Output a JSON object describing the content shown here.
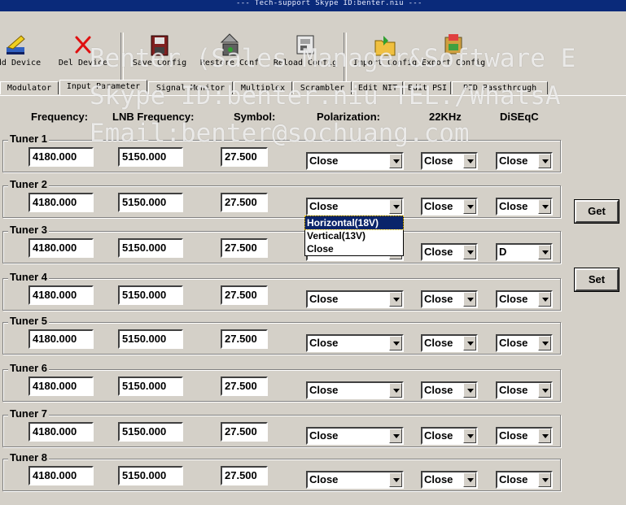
{
  "window": {
    "title": "--- Tech-support Skype ID:benter.niu ---"
  },
  "toolbar": {
    "items": [
      {
        "label": "Add Device",
        "icon": "add-device-icon"
      },
      {
        "label": "Del Device",
        "icon": "delete-icon"
      },
      {
        "label": "Save Config",
        "icon": "save-config-icon"
      },
      {
        "label": "Restore Conf",
        "icon": "restore-config-icon"
      },
      {
        "label": "Reload Config",
        "icon": "reload-config-icon"
      },
      {
        "label": "Import Config",
        "icon": "import-config-icon"
      },
      {
        "label": "Export Config",
        "icon": "export-config-icon"
      }
    ]
  },
  "tabs": [
    "Modulator",
    "Input Parameter",
    "Signal Monitor",
    "Multiplex",
    "Scrambler",
    "Edit NIT",
    "Edit PSI",
    "PID Passthrough"
  ],
  "active_tab": "Input Parameter",
  "headers": {
    "frequency": "Frequency:",
    "lnb": "LNB Frequency:",
    "symbol": "Symbol:",
    "polarization": "Polarization:",
    "khz": "22KHz",
    "diseqc": "DiSEqC"
  },
  "tuners": [
    {
      "name": "Tuner 1",
      "frequency": "4180.000",
      "lnb": "5150.000",
      "symbol": "27.500",
      "polarization": "Close",
      "khz": "Close",
      "diseqc": "Close"
    },
    {
      "name": "Tuner 2",
      "frequency": "4180.000",
      "lnb": "5150.000",
      "symbol": "27.500",
      "polarization": "Close",
      "khz": "Close",
      "diseqc": "Close"
    },
    {
      "name": "Tuner 3",
      "frequency": "4180.000",
      "lnb": "5150.000",
      "symbol": "27.500",
      "polarization": "",
      "khz": "Close",
      "diseqc": "D"
    },
    {
      "name": "Tuner 4",
      "frequency": "4180.000",
      "lnb": "5150.000",
      "symbol": "27.500",
      "polarization": "Close",
      "khz": "Close",
      "diseqc": "Close"
    },
    {
      "name": "Tuner 5",
      "frequency": "4180.000",
      "lnb": "5150.000",
      "symbol": "27.500",
      "polarization": "Close",
      "khz": "Close",
      "diseqc": "Close"
    },
    {
      "name": "Tuner 6",
      "frequency": "4180.000",
      "lnb": "5150.000",
      "symbol": "27.500",
      "polarization": "Close",
      "khz": "Close",
      "diseqc": "Close"
    },
    {
      "name": "Tuner 7",
      "frequency": "4180.000",
      "lnb": "5150.000",
      "symbol": "27.500",
      "polarization": "Close",
      "khz": "Close",
      "diseqc": "Close"
    },
    {
      "name": "Tuner 8",
      "frequency": "4180.000",
      "lnb": "5150.000",
      "symbol": "27.500",
      "polarization": "Close",
      "khz": "Close",
      "diseqc": "Close"
    }
  ],
  "dropdown": {
    "options": [
      "Horizontal(18V)",
      "Vertical(13V)",
      "Close"
    ],
    "selected": "Horizontal(18V)"
  },
  "buttons": {
    "get": "Get",
    "set": "Set"
  },
  "watermark": {
    "line1": "Benter (Sales Manager&Software E",
    "line2": "Skype ID:benter.niu  TEL./WhatsA",
    "line3": "Email:benter@sochuang.com"
  },
  "colors": {
    "face": "#d4d0c8",
    "highlight": "#0a246a",
    "titlebar": "#0a2a7a"
  }
}
